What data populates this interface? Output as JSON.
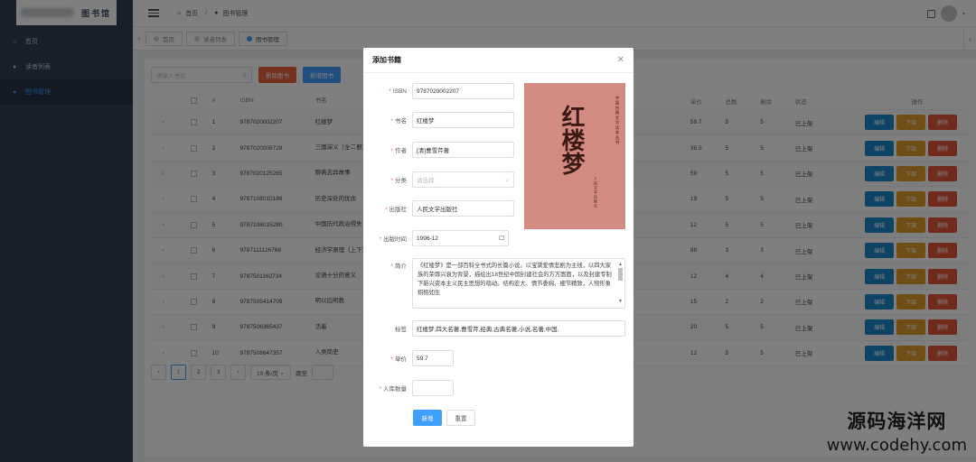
{
  "sidebar": {
    "logo_text": "图书馆",
    "items": [
      {
        "label": "首页",
        "icon": "home-icon"
      },
      {
        "label": "读者列表",
        "icon": "user-icon"
      },
      {
        "label": "图书管理",
        "icon": "book-icon"
      }
    ],
    "active_index": 2
  },
  "header": {
    "breadcrumb": [
      "首页",
      "图书管理"
    ]
  },
  "tags": [
    {
      "label": "首页",
      "active": false
    },
    {
      "label": "读者列表",
      "active": false
    },
    {
      "label": "图书管理",
      "active": true
    }
  ],
  "toolbar": {
    "search_placeholder": "请输入书名",
    "delete_label": "删除图书",
    "add_label": "新增图书"
  },
  "table": {
    "headers": [
      "#",
      "ISBN",
      "书名",
      "单价",
      "总数",
      "剩余",
      "状态",
      "操作"
    ],
    "rows": [
      {
        "no": "1",
        "isbn": "9787020002207",
        "name": "红楼梦",
        "price": "59.7",
        "total": "5",
        "remain": "5",
        "status": "已上架"
      },
      {
        "no": "2",
        "isbn": "9787020008728",
        "name": "三国演义（全二册）",
        "price": "39.5",
        "total": "5",
        "remain": "5",
        "status": "已上架"
      },
      {
        "no": "3",
        "isbn": "9787020125265",
        "name": "聊斋志异故事",
        "price": "59",
        "total": "5",
        "remain": "5",
        "status": "已上架"
      },
      {
        "no": "4",
        "isbn": "9787108010186",
        "name": "历史深处的忧虑",
        "price": "19",
        "total": "5",
        "remain": "5",
        "status": "已上架"
      },
      {
        "no": "5",
        "isbn": "9787108015280",
        "name": "中国历代政治得失",
        "price": "12",
        "total": "5",
        "remain": "5",
        "status": "已上架"
      },
      {
        "no": "6",
        "isbn": "9787111126768",
        "name": "经济学原理（上下）",
        "price": "88",
        "total": "3",
        "remain": "3",
        "status": "已上架"
      },
      {
        "no": "7",
        "isbn": "9787501162734",
        "name": "论语十分的意义",
        "price": "12",
        "total": "4",
        "remain": "4",
        "status": "已上架"
      },
      {
        "no": "8",
        "isbn": "9787505414709",
        "name": "明以后明教",
        "price": "15",
        "total": "2",
        "remain": "2",
        "status": "已上架"
      },
      {
        "no": "9",
        "isbn": "9787506365437",
        "name": "活着",
        "price": "20",
        "total": "5",
        "remain": "5",
        "status": "已上架"
      },
      {
        "no": "10",
        "isbn": "9787508647357",
        "name": "人类简史",
        "price": "12",
        "total": "5",
        "remain": "5",
        "status": "已上架"
      }
    ],
    "ops": {
      "edit": "编辑",
      "down": "下架",
      "del": "删除"
    }
  },
  "pager": {
    "pages": [
      "1",
      "2",
      "3"
    ],
    "active": "1",
    "size_label": "10 条/页",
    "jump_label": "跳至"
  },
  "modal": {
    "title": "添加书籍",
    "fields": {
      "isbn": {
        "label": "ISBN",
        "value": "9787020002207"
      },
      "name": {
        "label": "书名",
        "value": "红楼梦"
      },
      "author": {
        "label": "作者",
        "value": "[清]曹雪芹著"
      },
      "category": {
        "label": "分类",
        "placeholder": "请选择"
      },
      "publisher": {
        "label": "出版社",
        "value": "人民文学出版社"
      },
      "pubdate": {
        "label": "出版时间",
        "value": "1996-12"
      },
      "intro": {
        "label": "简介",
        "value": "《红楼梦》是一部百科全书式的长篇小说。以宝黛爱情悲剧为主线，以四大家族的荣辱兴衰为背景，描绘出18世纪中国封建社会的方方面面，以及封建专制下新兴资本主义民主思想的萌动。结构宏大、情节委婉、细节精致，人物形象栩栩如生"
      },
      "tags": {
        "label": "标签",
        "value": "红楼梦,四大名著,曹雪芹,经典,古典名著,小说,名著,中国,"
      },
      "price": {
        "label": "单价",
        "value": "59.7"
      },
      "stock": {
        "label": "入库数量",
        "value": ""
      }
    },
    "cover": {
      "title": "红楼梦",
      "series": "中国古典文学读本丛书",
      "publisher": "人民文学出版社"
    },
    "submit_label": "新增",
    "reset_label": "重置"
  },
  "watermark": {
    "cn": "源码海洋网",
    "en": "www.codehy.com"
  }
}
